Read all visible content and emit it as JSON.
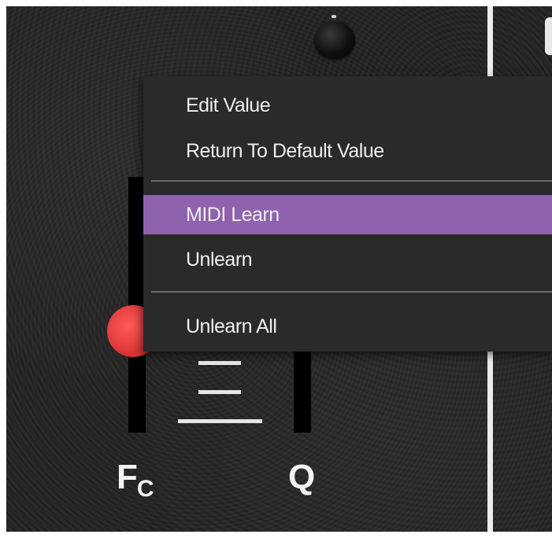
{
  "context_menu": {
    "items": [
      {
        "label": "Edit Value"
      },
      {
        "label": "Return To Default Value"
      },
      {
        "label": "MIDI Learn",
        "highlighted": true
      },
      {
        "label": "Unlearn"
      },
      {
        "label": "Unlearn All"
      }
    ]
  },
  "controls": {
    "fc_label_main": "F",
    "fc_label_sub": "C",
    "q_label": "Q",
    "fader_color": "#e03a3a",
    "highlight_color": "#8f62ae"
  }
}
